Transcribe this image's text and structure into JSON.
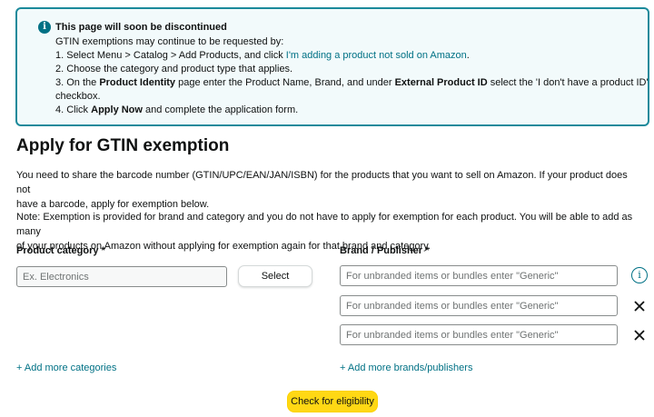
{
  "notice": {
    "icon": "info-icon",
    "title": "This page will soon be discontinued",
    "intro": "GTIN exemptions may continue to be requested by:",
    "step1_prefix": "1. Select Menu > Catalog > Add Products, and click ",
    "step1_link": "I'm adding a product not sold on Amazon",
    "step1_suffix": ".",
    "step2": "2. Choose the category and product type that applies.",
    "step3_prefix": "3. On the ",
    "step3_bold1": "Product Identity",
    "step3_mid": " page enter the Product Name, Brand, and under ",
    "step3_bold2": "External Product ID",
    "step3_suffix": " select the 'I don't have a product ID'",
    "step3_cont": "checkbox.",
    "step4_prefix": "4. Click ",
    "step4_bold": "Apply Now",
    "step4_suffix": " and complete the application form.",
    "border_color": "#1b8a9b"
  },
  "heading": "Apply for GTIN exemption",
  "para1_line1": "You need to share the barcode number (GTIN/UPC/EAN/JAN/ISBN) for the products that you want to sell on Amazon. If your product does not",
  "para1_line2": "have a barcode, apply for exemption below.",
  "para2_line1": "Note: Exemption is provided for brand and category and you do not have to apply for exemption for each product. You will be able to add as many",
  "para2_line2": "of your products on Amazon without applying for exemption again for that brand and category.",
  "category": {
    "label": "Product category *",
    "placeholder": "Ex. Electronics",
    "value": "",
    "select_label": "Select",
    "add_more": "+ Add more categories"
  },
  "brand": {
    "label": "Brand / Publisher *",
    "fields": [
      {
        "placeholder": "For unbranded items or bundles enter \"Generic\"",
        "value": "",
        "icon": "info-icon"
      },
      {
        "placeholder": "For unbranded items or bundles enter \"Generic\"",
        "value": "",
        "icon": "close-icon"
      },
      {
        "placeholder": "For unbranded items or bundles enter \"Generic\"",
        "value": "",
        "icon": "close-icon"
      }
    ],
    "add_more": "+ Add more brands/publishers"
  },
  "check_button": "Check for eligibility",
  "colors": {
    "link": "#007185",
    "primary_button": "#ffd814"
  }
}
